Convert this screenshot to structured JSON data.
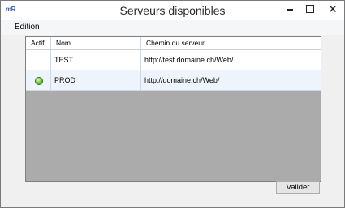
{
  "window": {
    "title": "Serveurs disponibles",
    "app_icon_text": "mR"
  },
  "menubar": {
    "items": [
      "Edition"
    ]
  },
  "grid": {
    "columns": [
      "Actif",
      "Nom",
      "Chemin du serveur"
    ],
    "rows": [
      {
        "active": false,
        "name": "TEST",
        "path": "http://test.domaine.ch/Web/"
      },
      {
        "active": true,
        "name": "PROD",
        "path": "http://domaine.ch/Web/"
      }
    ],
    "active_indicator_color": "#5cb82e"
  },
  "buttons": {
    "validate": "Valider"
  }
}
